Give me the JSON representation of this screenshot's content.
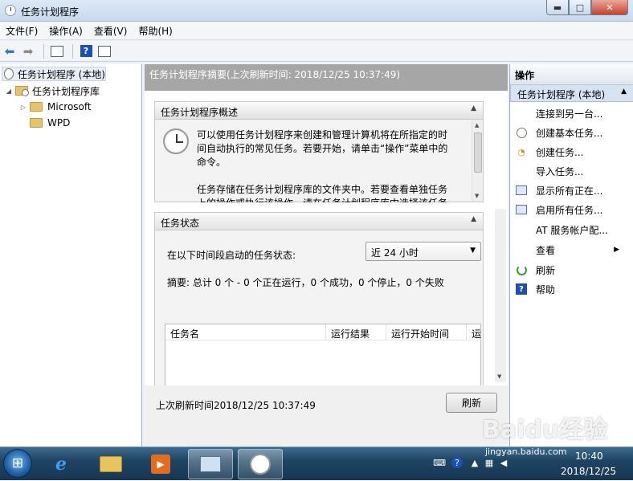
{
  "window": {
    "title": "任务计划程序"
  },
  "menubar": [
    "文件(F)",
    "操作(A)",
    "查看(V)",
    "帮助(H)"
  ],
  "tree": {
    "root": "任务计划程序 (本地)",
    "library": "任务计划程序库",
    "children": [
      "Microsoft",
      "WPD"
    ]
  },
  "center": {
    "header": "任务计划程序摘要(上次刷新时间: 2018/12/25 10:37:49)",
    "overview": {
      "title": "任务计划程序概述",
      "p1": "可以使用任务计划程序来创建和管理计算机将在所指定的时间自动执行的常见任务。若要开始，请单击“操作”菜单中的命令。",
      "p2": "任务存储在任务计划程序库的文件夹中。若要查看单独任务上的操作或执行该操作，请在任务计划程序库中选择该任务"
    },
    "status": {
      "title": "任务状态",
      "prompt": "在以下时间段启动的任务状态:",
      "period": "近 24 小时",
      "summary": "摘要: 总计 0 个 - 0 个正在运行，0 个成功，0 个停止，0 个失败",
      "columns": [
        "任务名",
        "运行结果",
        "运行开始时间",
        "运"
      ]
    },
    "footer": {
      "last_refresh": "上次刷新时间2018/12/25 10:37:49",
      "refresh_button": "刷新"
    }
  },
  "actions": {
    "title": "操作",
    "group": "任务计划程序 (本地)",
    "items": [
      "连接到另一台...",
      "创建基本任务...",
      "创建任务...",
      "导入任务...",
      "显示所有正在...",
      "启用所有任务...",
      "AT 服务帐户配...",
      "查看",
      "刷新",
      "帮助"
    ]
  },
  "taskbar": {
    "time": "10:40",
    "date": "2018/12/25"
  },
  "watermark": {
    "logo": "Baidu经验",
    "sub": "jingyan.baidu.com"
  }
}
